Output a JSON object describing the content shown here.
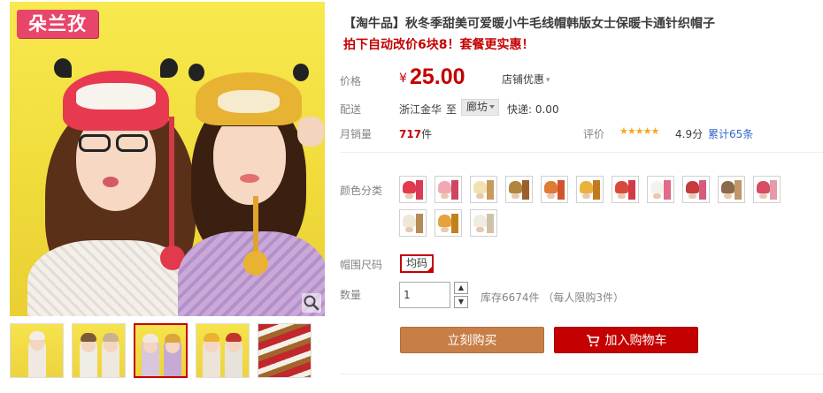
{
  "gallery": {
    "brand_logo": "朵兰孜",
    "zoom_icon": "zoom-magnifier-icon"
  },
  "product": {
    "title": "【淘牛品】秋冬季甜美可爱暖小牛毛线帽韩版女士保暖卡通针织帽子",
    "subtitle": "拍下自动改价6块8！套餐更实惠！"
  },
  "price": {
    "label": "价格",
    "currency": "¥",
    "value": "25.00",
    "promo": "店铺优惠",
    "promo_chevron": "▾"
  },
  "shipping": {
    "label": "配送",
    "from": "浙江金华",
    "to_word": "至",
    "destination": "廊坊",
    "fee": "快递: 0.00"
  },
  "sales": {
    "label": "月销量",
    "count": "717",
    "unit": "件"
  },
  "reviews": {
    "label": "评价",
    "stars": "★★★★★",
    "score": "4.9分",
    "total": "累计65条"
  },
  "sku": {
    "color_label": "颜色分类",
    "swatches": [
      {
        "hat": "#e33a4f",
        "pack": "#d83b55"
      },
      {
        "hat": "#f0a9b4",
        "pack": "#d04563"
      },
      {
        "hat": "#f3e1b5",
        "pack": "#c89a5b"
      },
      {
        "hat": "#b0863f",
        "pack": "#9a5f2a"
      },
      {
        "hat": "#e07a34",
        "pack": "#d1542d"
      },
      {
        "hat": "#e9b23a",
        "pack": "#c07a1f"
      },
      {
        "hat": "#d94a3a",
        "pack": "#d23a48"
      },
      {
        "hat": "#f4f2ee",
        "pack": "#e26b8a"
      },
      {
        "hat": "#c53b3b",
        "pack": "#d55b7b"
      },
      {
        "hat": "#8a6a4a",
        "pack": "#c0976a"
      },
      {
        "hat": "#d64c63",
        "pack": "#e49aa8"
      },
      {
        "hat": "#efe8d8",
        "pack": "#b78a5a"
      },
      {
        "hat": "#e4a43a",
        "pack": "#c48020"
      },
      {
        "hat": "#f1ece3",
        "pack": "#cfc2a8"
      }
    ],
    "size_label": "帽围尺码",
    "size_value": "均码",
    "qty_label": "数量",
    "qty_value": "1",
    "qty_up": "▲",
    "qty_down": "▼",
    "stock": "库存6674件 （每人限购3件）"
  },
  "actions": {
    "buy_now": "立刻购买",
    "add_cart": "加入购物车"
  },
  "thumbnails": [
    {
      "name": "thumb-1"
    },
    {
      "name": "thumb-2"
    },
    {
      "name": "thumb-3",
      "active": true
    },
    {
      "name": "thumb-4"
    },
    {
      "name": "thumb-5"
    }
  ],
  "colors": {
    "accent_red": "#c40000",
    "buy_button": "#c77e47",
    "link_blue": "#3366cc",
    "star_orange": "#f5a623"
  }
}
